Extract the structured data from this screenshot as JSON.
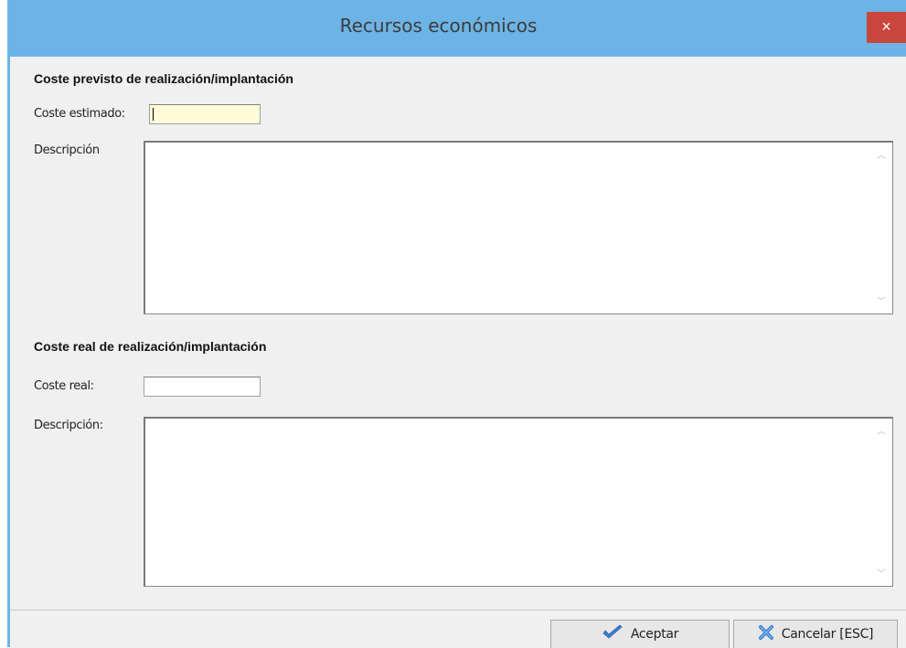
{
  "window": {
    "title": "Recursos económicos",
    "close_symbol": "×"
  },
  "section_planned": {
    "title": "Coste previsto de realización/implantación",
    "cost_label": "Coste estimado:",
    "cost_value": "",
    "description_label": "Descripción",
    "description_value": ""
  },
  "section_real": {
    "title": "Coste real de realización/implantación",
    "cost_label": "Coste real:",
    "cost_value": "",
    "description_label": "Descripción:",
    "description_value": ""
  },
  "footer": {
    "accept_label": "Aceptar",
    "accept_icon": "checkmark-icon",
    "cancel_label": "Cancelar [ESC]",
    "cancel_icon": "cross-icon"
  },
  "colors": {
    "titlebar": "#6cb4e6",
    "close_button": "#c9463d",
    "focused_input": "#fffbd8"
  }
}
